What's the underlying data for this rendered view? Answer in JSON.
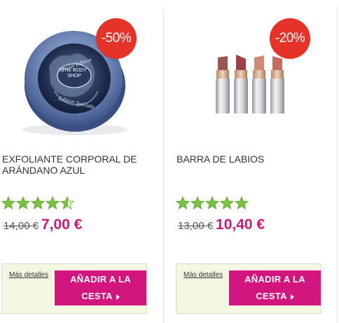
{
  "products": [
    {
      "discount": "-50%",
      "name": "EXFOLIANTE CORPORAL DE ARÁNDANO AZUL",
      "rating": 4.5,
      "old_price": "14,00 €",
      "new_price": "7,00 €",
      "details_label": "Más detalles",
      "add_line1": "AÑADIR A LA",
      "add_line2": "CESTA",
      "jar_text_1": "Special Edition",
      "jar_text_2": "THE BODY SHOP",
      "jar_text_3": "Edition Spéciale"
    },
    {
      "discount": "-20%",
      "name": "BARRA DE LABIOS",
      "rating": 5,
      "old_price": "13,00 €",
      "new_price": "10,40 €",
      "details_label": "Más detalles",
      "add_line1": "AÑADIR A LA",
      "add_line2": "CESTA"
    }
  ],
  "colors": {
    "badge": "#e5332a",
    "price": "#c8197f",
    "button": "#d2157f",
    "star": "#7bc243",
    "panel": "#f4f8e3"
  }
}
